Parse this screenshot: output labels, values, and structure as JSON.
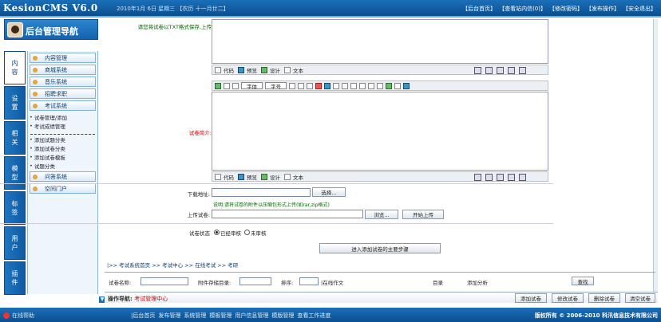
{
  "app": {
    "logo": "KesionCMS V6.0",
    "date": "2010年1月 6日 星期三 【农历 十一月廿二】"
  },
  "top_links": [
    "【后台首页】",
    "【查看站内信(0)】",
    "【修改密码】",
    "【发布操作】",
    "【安全退出】"
  ],
  "nav": {
    "title": "后台管理导航"
  },
  "vtabs": [
    {
      "l1": "内",
      "l2": "容"
    },
    {
      "l1": "设",
      "l2": "置"
    },
    {
      "l1": "相",
      "l2": "关"
    },
    {
      "l1": "模",
      "l2": "型"
    },
    {
      "l1": "标",
      "l2": "签"
    },
    {
      "l1": "用",
      "l2": "户"
    },
    {
      "l1": "插",
      "l2": "件"
    }
  ],
  "menu": {
    "b1": "内容管理",
    "b2": "商城系统",
    "b3": "音乐系统",
    "b4": "招聘求职",
    "b5": "考试系统",
    "s1": "试卷管理/添加",
    "s2": "考试成绩管理",
    "s3": "添加试题分类",
    "s4": "添加试卷分类",
    "s5": "添加试卷模板",
    "s6": "试题分类",
    "b6": "问答系统",
    "b7": "空间门户"
  },
  "form": {
    "file_hint": "请您将试卷以TXT格式保存,上传",
    "intro_label": "试卷简介:",
    "download_label": "下载地址:",
    "upload_label": "上传试卷:",
    "upload_note": "说明:请将试卷的附件以压缩包形式上传(如rar,zip格式)",
    "status_label": "试卷状态",
    "status_opts": [
      "已经审核",
      "未审核"
    ],
    "choose_btn": "选择...",
    "browse_btn": "浏览...",
    "upload_btn": "开始上传",
    "submit_btn": "进入添加试卷的主要步骤"
  },
  "editor_tabs": [
    "代码",
    "预览",
    "设计",
    "文本"
  ],
  "editor_fonts": {
    "font": "字体",
    "size": "字号"
  },
  "crumb": "|>> 考试系统首页 >> 考试中心 >> 在线考试 >> 考研",
  "filter": {
    "name": "试卷名称:",
    "path": "附件存储目录:",
    "order": "排序:",
    "search": "|在线作文",
    "dir": "目录",
    "add": "添加分析",
    "go": "查找"
  },
  "status": {
    "pre": "操作导航:",
    "val": "考试管理中心"
  },
  "status_btns": [
    "添加试卷",
    "修改试卷",
    "删除试卷",
    "清空试卷"
  ],
  "footer": {
    "left": "在线帮助",
    "links": [
      "|后台首页",
      "发布管理",
      "系统管理",
      "模板管理",
      "用户信息管理",
      "模版管理",
      "查看工作进度"
    ],
    "cp": "版权所有 © 2006-2010 科汛信息技术有限公司"
  }
}
